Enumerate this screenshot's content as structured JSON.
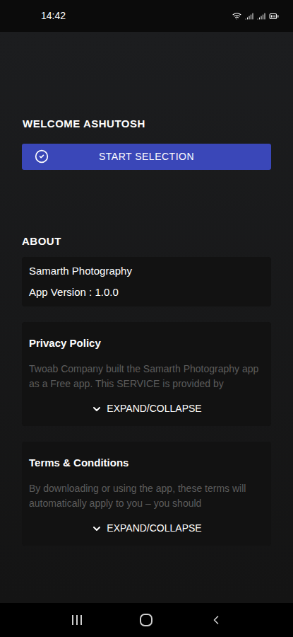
{
  "status_bar": {
    "time": "14:42"
  },
  "welcome": "WELCOME ASHUTOSH",
  "start_button": "START SELECTION",
  "about_heading": "ABOUT",
  "app_info": {
    "name": "Samarth Photography",
    "version": "App Version : 1.0.0"
  },
  "sections": [
    {
      "title": "Privacy Policy",
      "preview": "Twoab Company built the Samarth Photography app as a Free app. This SERVICE is provided by",
      "toggle": "EXPAND/COLLAPSE",
      "expanded": false
    },
    {
      "title": "Terms & Conditions",
      "preview": "By downloading or using the app, these terms will automatically apply to you – you should",
      "toggle": "EXPAND/COLLAPSE",
      "expanded": false
    }
  ]
}
